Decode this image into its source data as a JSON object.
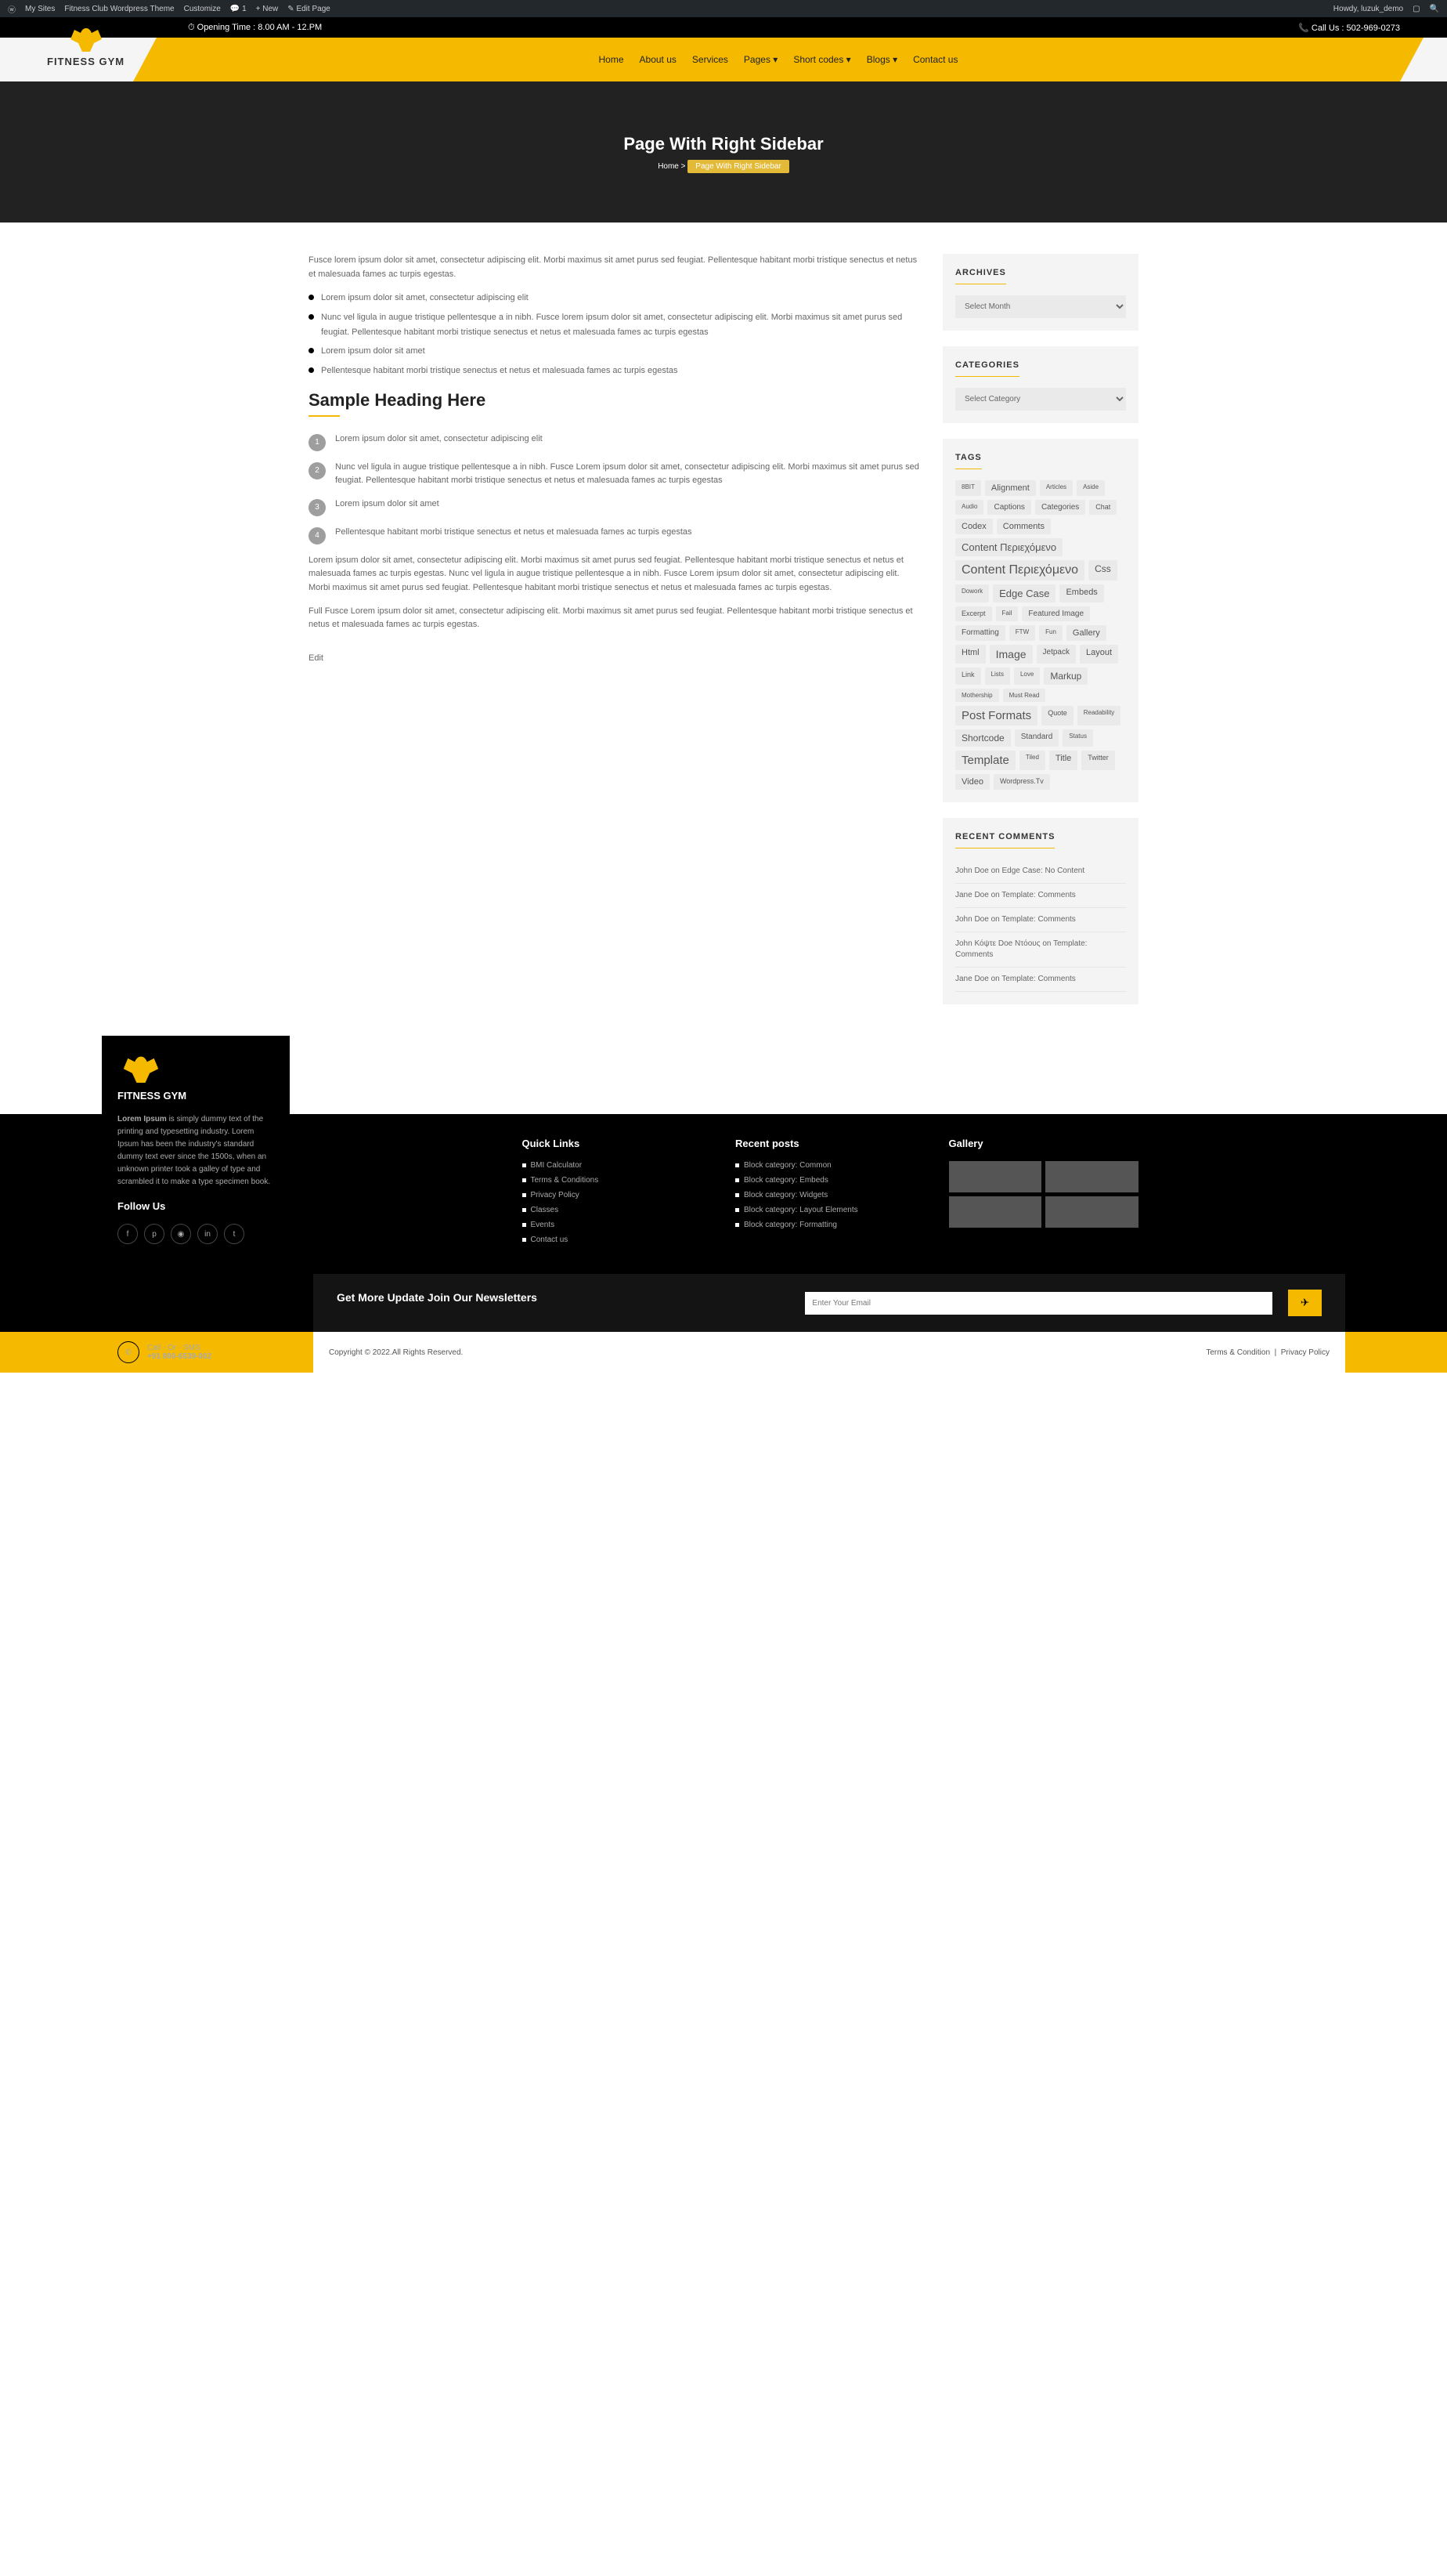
{
  "admin": {
    "mysites": "My Sites",
    "theme": "Fitness Club Wordpress Theme",
    "customize": "Customize",
    "comments": "1",
    "new": "New",
    "edit": "Edit Page",
    "howdy": "Howdy, luzuk_demo"
  },
  "topbar": {
    "hours": "⏱ Opening Time : 8.00 AM - 12.PM",
    "call": "📞 Call Us : 502-969-0273"
  },
  "brand": "FITNESS GYM",
  "nav": [
    "Home",
    "About us",
    "Services",
    "Pages ▾",
    "Short codes ▾",
    "Blogs ▾",
    "Contact us"
  ],
  "hero": {
    "title": "Page With Right Sidebar",
    "bc_home": "Home",
    "bc_sep": ">",
    "bc_current": "Page With Right Sidebar"
  },
  "content": {
    "p1": "Fusce lorem ipsum dolor sit amet, consectetur adipiscing elit. Morbi maximus sit amet purus sed feugiat. Pellentesque habitant morbi tristique senectus et netus et malesuada fames ac turpis egestas.",
    "ul": [
      "Lorem ipsum dolor sit amet, consectetur adipiscing elit",
      "Nunc vel ligula in augue tristique pellentesque a in nibh. Fusce lorem ipsum dolor sit amet, consectetur adipiscing elit. Morbi maximus sit amet purus sed feugiat. Pellentesque habitant morbi tristique senectus et netus et malesuada fames ac turpis egestas",
      "Lorem ipsum dolor sit amet",
      "Pellentesque habitant morbi tristique senectus et netus et malesuada fames ac turpis egestas"
    ],
    "h2": "Sample Heading Here",
    "ol": [
      "Lorem ipsum dolor sit amet, consectetur adipiscing elit",
      "Nunc vel ligula in augue tristique pellentesque a in nibh. Fusce Lorem ipsum dolor sit amet, consectetur adipiscing elit. Morbi maximus sit amet purus sed feugiat. Pellentesque habitant morbi tristique senectus et netus et malesuada fames ac turpis egestas",
      "Lorem ipsum dolor sit amet",
      "Pellentesque habitant morbi tristique senectus et netus et malesuada fames ac turpis egestas"
    ],
    "p2": "Lorem ipsum dolor sit amet, consectetur adipiscing elit. Morbi maximus sit amet purus sed feugiat. Pellentesque habitant morbi tristique senectus et netus et malesuada fames ac turpis egestas. Nunc vel ligula in augue tristique pellentesque a in nibh. Fusce Lorem ipsum dolor sit amet, consectetur adipiscing elit. Morbi maximus sit amet purus sed feugiat. Pellentesque habitant morbi tristique senectus et netus et malesuada fames ac turpis egestas.",
    "p3": "Full Fusce Lorem ipsum dolor sit amet, consectetur adipiscing elit. Morbi maximus sit amet purus sed feugiat. Pellentesque habitant morbi tristique senectus et netus et malesuada fames ac turpis egestas.",
    "edit": "Edit"
  },
  "widgets": {
    "archives": {
      "title": "ARCHIVES",
      "select": "Select Month"
    },
    "categories": {
      "title": "CATEGORIES",
      "select": "Select Category"
    },
    "tags": {
      "title": "TAGS",
      "items": [
        {
          "t": "8BIT",
          "s": 8
        },
        {
          "t": "Alignment",
          "s": 11
        },
        {
          "t": "Articles",
          "s": 8
        },
        {
          "t": "Aside",
          "s": 8
        },
        {
          "t": "Audio",
          "s": 8
        },
        {
          "t": "Captions",
          "s": 10
        },
        {
          "t": "Categories",
          "s": 10
        },
        {
          "t": "Chat",
          "s": 9
        },
        {
          "t": "Codex",
          "s": 11
        },
        {
          "t": "Comments",
          "s": 11
        },
        {
          "t": "Content Περιεχόμενο",
          "s": 13
        },
        {
          "t": "Content Περιεχόμενο",
          "s": 16
        },
        {
          "t": "Css",
          "s": 12
        },
        {
          "t": "Dowork",
          "s": 8
        },
        {
          "t": "Edge Case",
          "s": 13
        },
        {
          "t": "Embeds",
          "s": 11
        },
        {
          "t": "Excerpt",
          "s": 9
        },
        {
          "t": "Fail",
          "s": 8
        },
        {
          "t": "Featured Image",
          "s": 10
        },
        {
          "t": "Formatting",
          "s": 10
        },
        {
          "t": "FTW",
          "s": 8
        },
        {
          "t": "Fun",
          "s": 8
        },
        {
          "t": "Gallery",
          "s": 11
        },
        {
          "t": "Html",
          "s": 11
        },
        {
          "t": "Image",
          "s": 14
        },
        {
          "t": "Jetpack",
          "s": 10
        },
        {
          "t": "Layout",
          "s": 11
        },
        {
          "t": "Link",
          "s": 9
        },
        {
          "t": "Lists",
          "s": 8
        },
        {
          "t": "Love",
          "s": 8
        },
        {
          "t": "Markup",
          "s": 12
        },
        {
          "t": "Mothership",
          "s": 8
        },
        {
          "t": "Must Read",
          "s": 8
        },
        {
          "t": "Post Formats",
          "s": 15
        },
        {
          "t": "Quote",
          "s": 9
        },
        {
          "t": "Readability",
          "s": 8
        },
        {
          "t": "Shortcode",
          "s": 12
        },
        {
          "t": "Standard",
          "s": 10
        },
        {
          "t": "Status",
          "s": 8
        },
        {
          "t": "Template",
          "s": 15
        },
        {
          "t": "Tiled",
          "s": 8
        },
        {
          "t": "Title",
          "s": 11
        },
        {
          "t": "Twitter",
          "s": 9
        },
        {
          "t": "Video",
          "s": 11
        },
        {
          "t": "Wordpress.Tv",
          "s": 9
        }
      ]
    },
    "recent_comments": {
      "title": "RECENT COMMENTS",
      "items": [
        "John Doe on Edge Case: No Content",
        "Jane Doe on Template: Comments",
        "John Doe on Template: Comments",
        "John Κόψτε Doe Ντόους on Template: Comments",
        "Jane Doe on Template: Comments"
      ]
    }
  },
  "footer": {
    "brand": "FITNESS GYM",
    "lorem_label": "Lorem Ipsum",
    "desc": " is simply dummy text of the printing and typesetting industry. Lorem Ipsum has been the industry's standard dummy text ever since the 1500s, when an unknown printer took a galley of type and scrambled it to make a type specimen book.",
    "follow": "Follow Us",
    "quick_title": "Quick Links",
    "quick": [
      "BMI Calculator",
      "Terms & Conditions",
      "Privacy Policy",
      "Classes",
      "Events",
      "Contact us"
    ],
    "recent_title": "Recent posts",
    "recent": [
      "Block category: Common",
      "Block category: Embeds",
      "Block category: Widgets",
      "Block category: Layout Elements",
      "Block category: Formatting"
    ],
    "gallery_title": "Gallery",
    "newsletter_title": "Get More Update Join Our Newsletters",
    "newsletter_placeholder": "Enter Your Email",
    "call_label": "Call - Or - SMS",
    "call_num": "+91 800-6539-002",
    "copyright": "Copyright © 2022.All Rights Reserved.",
    "terms": "Terms & Condition",
    "privacy": "Privacy Policy"
  }
}
